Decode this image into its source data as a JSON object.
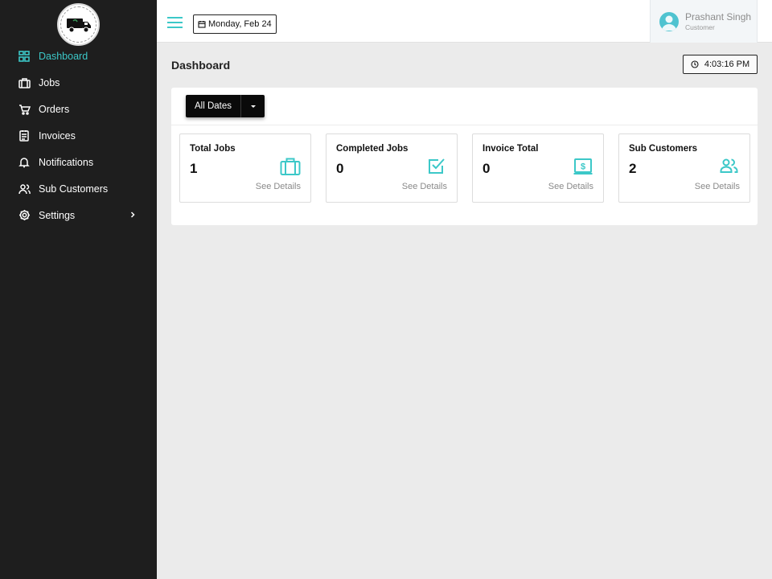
{
  "colors": {
    "accent": "#3cc8c8",
    "sidebar_bg": "#1e1e1e",
    "page_bg": "#ebebeb"
  },
  "sidebar": {
    "logo_icon": "delivery-truck-logo",
    "items": [
      {
        "label": "Dashboard",
        "icon": "grid-icon",
        "active": true
      },
      {
        "label": "Jobs",
        "icon": "briefcase-icon"
      },
      {
        "label": "Orders",
        "icon": "cart-icon"
      },
      {
        "label": "Invoices",
        "icon": "invoice-icon"
      },
      {
        "label": "Notifications",
        "icon": "bell-icon"
      },
      {
        "label": "Sub Customers",
        "icon": "users-icon"
      },
      {
        "label": "Settings",
        "icon": "gear-icon",
        "has_submenu": true
      }
    ]
  },
  "topbar": {
    "menu_icon": "hamburger-icon",
    "date": "Monday, Feb 24",
    "user": {
      "name": "Prashant Singh",
      "role": "Customer"
    }
  },
  "main": {
    "title": "Dashboard",
    "time": "4:03:16 PM",
    "date_filter": "All Dates",
    "cards": [
      {
        "title": "Total Jobs",
        "value": "1",
        "icon": "briefcase-icon",
        "link": "See Details"
      },
      {
        "title": "Completed Jobs",
        "value": "0",
        "icon": "checkbox-icon",
        "link": "See Details"
      },
      {
        "title": "Invoice Total",
        "value": "0",
        "icon": "dollar-bill-icon",
        "link": "See Details"
      },
      {
        "title": "Sub Customers",
        "value": "2",
        "icon": "users-icon",
        "link": "See Details"
      }
    ]
  }
}
